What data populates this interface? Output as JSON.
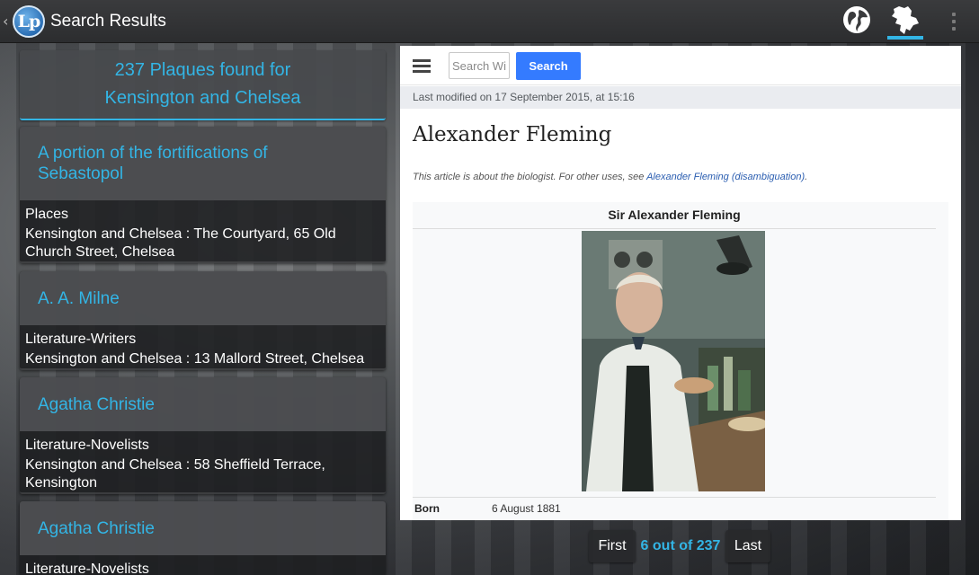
{
  "actionbar": {
    "title": "Search Results",
    "logo_text": "Lp",
    "back_glyph": "‹",
    "icons": [
      "globe-icon",
      "map-icon",
      "overflow-menu-icon"
    ],
    "accent_color": "#33b5e5"
  },
  "results": {
    "summary_line1": "237 Plaques found for",
    "summary_line2": "Kensington and Chelsea",
    "items": [
      {
        "name_line1": "A portion of the fortifications of",
        "name_line2": "Sebastopol",
        "category": "Places",
        "location_line1": "Kensington and Chelsea : The Courtyard, 65 Old",
        "location_line2": "Church Street, Chelsea"
      },
      {
        "name_line1": "A. A. Milne",
        "category": "Literature-Writers",
        "location_line1": "Kensington and Chelsea : 13 Mallord Street, Chelsea"
      },
      {
        "name_line1": "Agatha Christie",
        "category": "Literature-Novelists",
        "location_line1": "Kensington and Chelsea : 58 Sheffield Terrace,",
        "location_line2": "Kensington"
      },
      {
        "name_line1": "Agatha Christie",
        "category": "Literature-Novelists"
      }
    ]
  },
  "wiki": {
    "search_placeholder": "Search Wikipedia",
    "search_button": "Search",
    "last_modified": "Last modified on 17 September 2015, at 15:16",
    "article_title": "Alexander Fleming",
    "hatnote_prefix": "This article is about the biologist. For other uses, see ",
    "hatnote_link": "Alexander Fleming (disambiguation)",
    "hatnote_suffix": ".",
    "infobox_title": "Sir Alexander Fleming",
    "born_label": "Born",
    "born_value": "6 August 1881",
    "link_color": "#2a5db0",
    "button_color": "#347bff"
  },
  "pager": {
    "first": "First",
    "status": "6 out of 237",
    "last": "Last"
  }
}
